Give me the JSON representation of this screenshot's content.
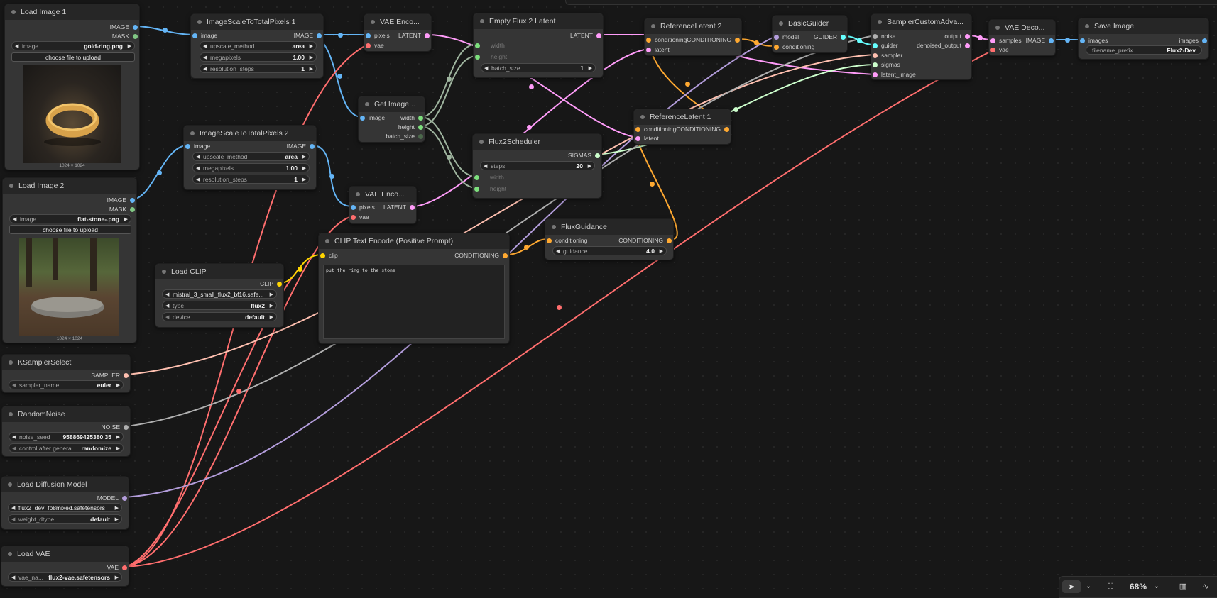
{
  "colors": {
    "image": "#64b5f6",
    "mask": "#81c784",
    "latent": "#ff9cf9",
    "vae": "#ff6e6e",
    "clip": "#ffd500",
    "conditioning": "#ffa931",
    "model": "#b39ddb",
    "int": "#7ddf7d",
    "sigmas": "#cdffcd",
    "sampler": "#ffc0b0",
    "noise": "#b0b0b0",
    "guider": "#66ffff"
  },
  "nodes": {
    "load_image_1": {
      "title": "Load Image 1",
      "out_image": "IMAGE",
      "out_mask": "MASK",
      "w_label": "image",
      "w_value": "gold-ring.png",
      "upload": "choose file to upload",
      "caption": "1024 × 1024"
    },
    "load_image_2": {
      "title": "Load Image 2",
      "out_image": "IMAGE",
      "out_mask": "MASK",
      "w_label": "image",
      "w_value": "flat-stone-.png",
      "upload": "choose file to upload",
      "caption": "1024 × 1024"
    },
    "scale1": {
      "title": "ImageScaleToTotalPixels 1",
      "in_image": "image",
      "out_image": "IMAGE",
      "w1l": "upscale_method",
      "w1v": "area",
      "w2l": "megapixels",
      "w2v": "1.00",
      "w3l": "resolution_steps",
      "w3v": "1"
    },
    "scale2": {
      "title": "ImageScaleToTotalPixels 2",
      "in_image": "image",
      "out_image": "IMAGE",
      "w1l": "upscale_method",
      "w1v": "area",
      "w2l": "megapixels",
      "w2v": "1.00",
      "w3l": "resolution_steps",
      "w3v": "1"
    },
    "vae_enc1": {
      "title": "VAE Enco...",
      "in_pixels": "pixels",
      "in_vae": "vae",
      "out_latent": "LATENT"
    },
    "vae_enc2": {
      "title": "VAE Enco...",
      "in_pixels": "pixels",
      "in_vae": "vae",
      "out_latent": "LATENT"
    },
    "get_image": {
      "title": "Get Image...",
      "in_image": "image",
      "out_width": "width",
      "out_height": "height",
      "out_batch": "batch_size"
    },
    "empty_latent": {
      "title": "Empty Flux 2 Latent",
      "out_latent": "LATENT",
      "in_width": "width",
      "in_height": "height",
      "w_label": "batch_size",
      "w_value": "1"
    },
    "scheduler": {
      "title": "Flux2Scheduler",
      "out_sigmas": "SIGMAS",
      "w_label": "steps",
      "w_value": "20",
      "in_width": "width",
      "in_height": "height"
    },
    "ref2": {
      "title": "ReferenceLatent 2",
      "in_cond": "conditioning",
      "out_cond": "CONDITIONING",
      "in_latent": "latent"
    },
    "ref1": {
      "title": "ReferenceLatent 1",
      "in_cond": "conditioning",
      "out_cond": "CONDITIONING",
      "in_latent": "latent"
    },
    "guider": {
      "title": "BasicGuider",
      "in_model": "model",
      "out_guider": "GUIDER",
      "in_cond": "conditioning"
    },
    "sampler": {
      "title": "SamplerCustomAdva...",
      "in_noise": "noise",
      "in_guider": "guider",
      "in_sampler": "sampler",
      "in_sigmas": "sigmas",
      "in_latent": "latent_image",
      "out_output": "output",
      "out_denoised": "denoised_output"
    },
    "vae_dec": {
      "title": "VAE Deco...",
      "in_samples": "samples",
      "in_vae": "vae",
      "out_image": "IMAGE"
    },
    "save": {
      "title": "Save Image",
      "in_images": "images",
      "out_images": "images",
      "w_label": "filename_prefix",
      "w_value": "Flux2-Dev"
    },
    "flux_guidance": {
      "title": "FluxGuidance",
      "in_cond": "conditioning",
      "out_cond": "CONDITIONING",
      "w_label": "guidance",
      "w_value": "4.0"
    },
    "clip_text": {
      "title": "CLIP Text Encode (Positive Prompt)",
      "in_clip": "clip",
      "out_cond": "CONDITIONING",
      "prompt": "put the ring to the stone"
    },
    "load_clip": {
      "title": "Load CLIP",
      "out_clip": "CLIP",
      "w1v": "mistral_3_small_flux2_bf16.safe...",
      "w2l": "type",
      "w2v": "flux2",
      "w3l": "device",
      "w3v": "default"
    },
    "ksampler_select": {
      "title": "KSamplerSelect",
      "out_sampler": "SAMPLER",
      "w_label": "sampler_name",
      "w_value": "euler"
    },
    "random_noise": {
      "title": "RandomNoise",
      "out_noise": "NOISE",
      "w1l": "noise_seed",
      "w1v": "958869425380 35",
      "w2l": "control after genera...",
      "w2v": "randomize"
    },
    "load_model": {
      "title": "Load Diffusion Model",
      "out_model": "MODEL",
      "w1v": "flux2_dev_fp8mixed.safetensors",
      "w2l": "weight_dtype",
      "w2v": "default"
    },
    "load_vae": {
      "title": "Load VAE",
      "out_vae": "VAE",
      "w_label": "vae_na...",
      "w_value": "flux2-vae.safetensors"
    }
  },
  "toolbar": {
    "zoom": "68%",
    "select_icon": "pointer-icon",
    "fit_icon": "fit-view-icon",
    "map_icon": "minimap-icon"
  }
}
